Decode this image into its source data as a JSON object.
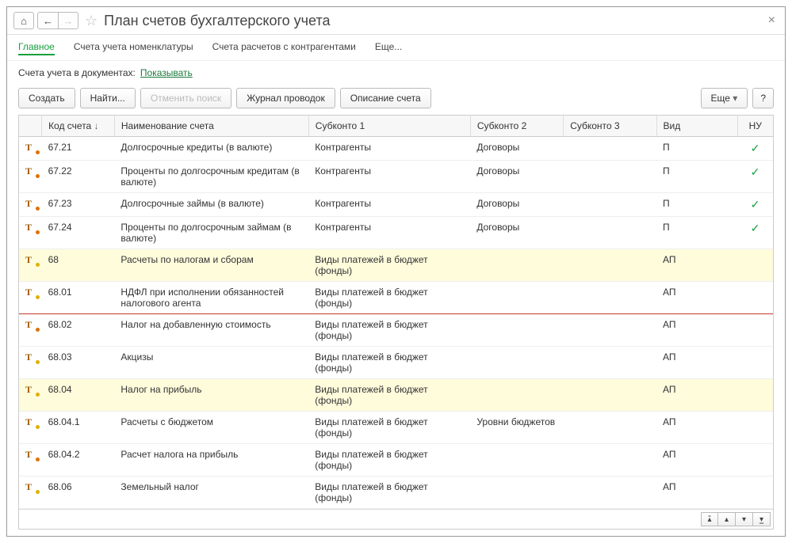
{
  "title": "План счетов бухгалтерского учета",
  "tabs": {
    "main": "Главное",
    "nom": "Счета учета номенклатуры",
    "contr": "Счета расчетов с контрагентами",
    "more": "Еще..."
  },
  "subbar": {
    "label": "Счета учета в документах:",
    "link": "Показывать"
  },
  "toolbar": {
    "create": "Создать",
    "find": "Найти...",
    "cancel": "Отменить поиск",
    "journal": "Журнал проводок",
    "desc": "Описание счета",
    "more": "Еще",
    "help": "?"
  },
  "columns": {
    "code": "Код счета",
    "name": "Наименование счета",
    "s1": "Субконто 1",
    "s2": "Субконто 2",
    "s3": "Субконто 3",
    "vid": "Вид",
    "nu": "НУ"
  },
  "rows": [
    {
      "ic": "o",
      "code": "67.21",
      "name": "Долгосрочные кредиты (в валюте)",
      "s1": "Контрагенты",
      "s2": "Договоры",
      "s3": "",
      "vid": "П",
      "nu": true,
      "hl": false,
      "red": false
    },
    {
      "ic": "o",
      "code": "67.22",
      "name": "Проценты по долгосрочным кредитам (в валюте)",
      "s1": "Контрагенты",
      "s2": "Договоры",
      "s3": "",
      "vid": "П",
      "nu": true,
      "hl": false,
      "red": false
    },
    {
      "ic": "o",
      "code": "67.23",
      "name": "Долгосрочные займы (в валюте)",
      "s1": "Контрагенты",
      "s2": "Договоры",
      "s3": "",
      "vid": "П",
      "nu": true,
      "hl": false,
      "red": false
    },
    {
      "ic": "o",
      "code": "67.24",
      "name": "Проценты по долгосрочным займам (в валюте)",
      "s1": "Контрагенты",
      "s2": "Договоры",
      "s3": "",
      "vid": "П",
      "nu": true,
      "hl": false,
      "red": false
    },
    {
      "ic": "g",
      "code": "68",
      "name": "Расчеты по налогам и сборам",
      "s1": "Виды платежей в бюджет (фонды)",
      "s2": "",
      "s3": "",
      "vid": "АП",
      "nu": false,
      "hl": true,
      "red": false
    },
    {
      "ic": "g",
      "code": "68.01",
      "name": "НДФЛ при исполнении обязанностей налогового агента",
      "s1": "Виды платежей в бюджет (фонды)",
      "s2": "",
      "s3": "",
      "vid": "АП",
      "nu": false,
      "hl": false,
      "red": true
    },
    {
      "ic": "o",
      "code": "68.02",
      "name": "Налог на добавленную стоимость",
      "s1": "Виды платежей в бюджет (фонды)",
      "s2": "",
      "s3": "",
      "vid": "АП",
      "nu": false,
      "hl": false,
      "red": false
    },
    {
      "ic": "g",
      "code": "68.03",
      "name": "Акцизы",
      "s1": "Виды платежей в бюджет (фонды)",
      "s2": "",
      "s3": "",
      "vid": "АП",
      "nu": false,
      "hl": false,
      "red": false
    },
    {
      "ic": "g",
      "code": "68.04",
      "name": "Налог на прибыль",
      "s1": "Виды платежей в бюджет (фонды)",
      "s2": "",
      "s3": "",
      "vid": "АП",
      "nu": false,
      "hl": true,
      "red": false
    },
    {
      "ic": "g",
      "code": "68.04.1",
      "name": "Расчеты с бюджетом",
      "s1": "Виды платежей в бюджет (фонды)",
      "s2": "Уровни бюджетов",
      "s3": "",
      "vid": "АП",
      "nu": false,
      "hl": false,
      "red": false
    },
    {
      "ic": "o",
      "code": "68.04.2",
      "name": "Расчет налога на прибыль",
      "s1": "Виды платежей в бюджет (фонды)",
      "s2": "",
      "s3": "",
      "vid": "АП",
      "nu": false,
      "hl": false,
      "red": false
    },
    {
      "ic": "g",
      "code": "68.06",
      "name": "Земельный налог",
      "s1": "Виды платежей в бюджет (фонды)",
      "s2": "",
      "s3": "",
      "vid": "АП",
      "nu": false,
      "hl": false,
      "red": false
    }
  ]
}
